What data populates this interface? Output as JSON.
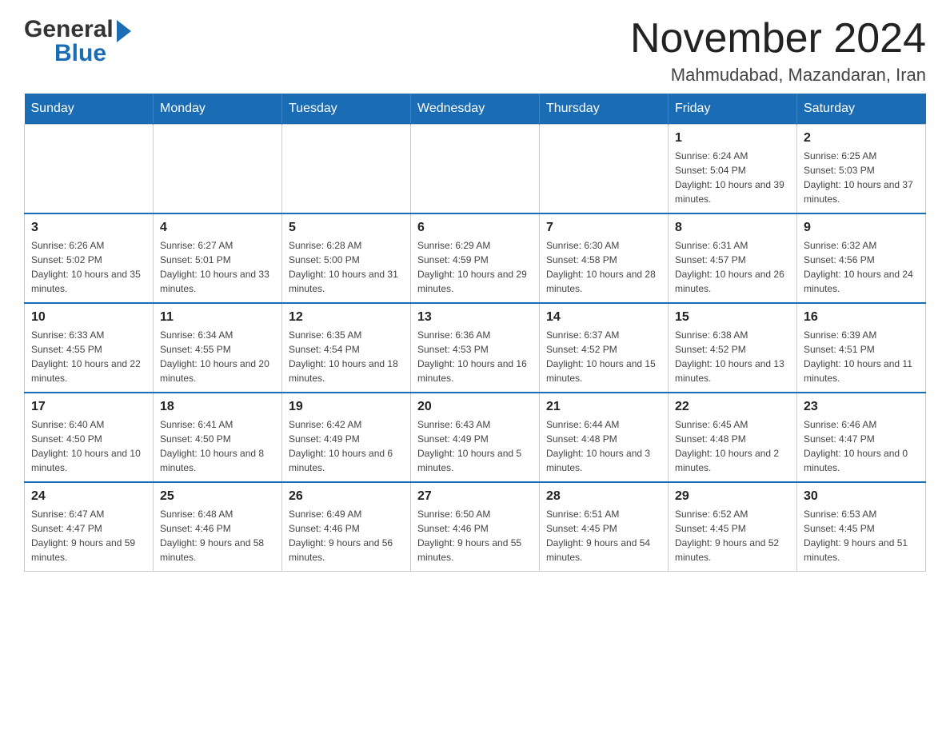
{
  "header": {
    "logo_general": "General",
    "logo_blue": "Blue",
    "title": "November 2024",
    "subtitle": "Mahmudabad, Mazandaran, Iran"
  },
  "weekdays": [
    "Sunday",
    "Monday",
    "Tuesday",
    "Wednesday",
    "Thursday",
    "Friday",
    "Saturday"
  ],
  "weeks": [
    [
      {
        "day": "",
        "sunrise": "",
        "sunset": "",
        "daylight": ""
      },
      {
        "day": "",
        "sunrise": "",
        "sunset": "",
        "daylight": ""
      },
      {
        "day": "",
        "sunrise": "",
        "sunset": "",
        "daylight": ""
      },
      {
        "day": "",
        "sunrise": "",
        "sunset": "",
        "daylight": ""
      },
      {
        "day": "",
        "sunrise": "",
        "sunset": "",
        "daylight": ""
      },
      {
        "day": "1",
        "sunrise": "Sunrise: 6:24 AM",
        "sunset": "Sunset: 5:04 PM",
        "daylight": "Daylight: 10 hours and 39 minutes."
      },
      {
        "day": "2",
        "sunrise": "Sunrise: 6:25 AM",
        "sunset": "Sunset: 5:03 PM",
        "daylight": "Daylight: 10 hours and 37 minutes."
      }
    ],
    [
      {
        "day": "3",
        "sunrise": "Sunrise: 6:26 AM",
        "sunset": "Sunset: 5:02 PM",
        "daylight": "Daylight: 10 hours and 35 minutes."
      },
      {
        "day": "4",
        "sunrise": "Sunrise: 6:27 AM",
        "sunset": "Sunset: 5:01 PM",
        "daylight": "Daylight: 10 hours and 33 minutes."
      },
      {
        "day": "5",
        "sunrise": "Sunrise: 6:28 AM",
        "sunset": "Sunset: 5:00 PM",
        "daylight": "Daylight: 10 hours and 31 minutes."
      },
      {
        "day": "6",
        "sunrise": "Sunrise: 6:29 AM",
        "sunset": "Sunset: 4:59 PM",
        "daylight": "Daylight: 10 hours and 29 minutes."
      },
      {
        "day": "7",
        "sunrise": "Sunrise: 6:30 AM",
        "sunset": "Sunset: 4:58 PM",
        "daylight": "Daylight: 10 hours and 28 minutes."
      },
      {
        "day": "8",
        "sunrise": "Sunrise: 6:31 AM",
        "sunset": "Sunset: 4:57 PM",
        "daylight": "Daylight: 10 hours and 26 minutes."
      },
      {
        "day": "9",
        "sunrise": "Sunrise: 6:32 AM",
        "sunset": "Sunset: 4:56 PM",
        "daylight": "Daylight: 10 hours and 24 minutes."
      }
    ],
    [
      {
        "day": "10",
        "sunrise": "Sunrise: 6:33 AM",
        "sunset": "Sunset: 4:55 PM",
        "daylight": "Daylight: 10 hours and 22 minutes."
      },
      {
        "day": "11",
        "sunrise": "Sunrise: 6:34 AM",
        "sunset": "Sunset: 4:55 PM",
        "daylight": "Daylight: 10 hours and 20 minutes."
      },
      {
        "day": "12",
        "sunrise": "Sunrise: 6:35 AM",
        "sunset": "Sunset: 4:54 PM",
        "daylight": "Daylight: 10 hours and 18 minutes."
      },
      {
        "day": "13",
        "sunrise": "Sunrise: 6:36 AM",
        "sunset": "Sunset: 4:53 PM",
        "daylight": "Daylight: 10 hours and 16 minutes."
      },
      {
        "day": "14",
        "sunrise": "Sunrise: 6:37 AM",
        "sunset": "Sunset: 4:52 PM",
        "daylight": "Daylight: 10 hours and 15 minutes."
      },
      {
        "day": "15",
        "sunrise": "Sunrise: 6:38 AM",
        "sunset": "Sunset: 4:52 PM",
        "daylight": "Daylight: 10 hours and 13 minutes."
      },
      {
        "day": "16",
        "sunrise": "Sunrise: 6:39 AM",
        "sunset": "Sunset: 4:51 PM",
        "daylight": "Daylight: 10 hours and 11 minutes."
      }
    ],
    [
      {
        "day": "17",
        "sunrise": "Sunrise: 6:40 AM",
        "sunset": "Sunset: 4:50 PM",
        "daylight": "Daylight: 10 hours and 10 minutes."
      },
      {
        "day": "18",
        "sunrise": "Sunrise: 6:41 AM",
        "sunset": "Sunset: 4:50 PM",
        "daylight": "Daylight: 10 hours and 8 minutes."
      },
      {
        "day": "19",
        "sunrise": "Sunrise: 6:42 AM",
        "sunset": "Sunset: 4:49 PM",
        "daylight": "Daylight: 10 hours and 6 minutes."
      },
      {
        "day": "20",
        "sunrise": "Sunrise: 6:43 AM",
        "sunset": "Sunset: 4:49 PM",
        "daylight": "Daylight: 10 hours and 5 minutes."
      },
      {
        "day": "21",
        "sunrise": "Sunrise: 6:44 AM",
        "sunset": "Sunset: 4:48 PM",
        "daylight": "Daylight: 10 hours and 3 minutes."
      },
      {
        "day": "22",
        "sunrise": "Sunrise: 6:45 AM",
        "sunset": "Sunset: 4:48 PM",
        "daylight": "Daylight: 10 hours and 2 minutes."
      },
      {
        "day": "23",
        "sunrise": "Sunrise: 6:46 AM",
        "sunset": "Sunset: 4:47 PM",
        "daylight": "Daylight: 10 hours and 0 minutes."
      }
    ],
    [
      {
        "day": "24",
        "sunrise": "Sunrise: 6:47 AM",
        "sunset": "Sunset: 4:47 PM",
        "daylight": "Daylight: 9 hours and 59 minutes."
      },
      {
        "day": "25",
        "sunrise": "Sunrise: 6:48 AM",
        "sunset": "Sunset: 4:46 PM",
        "daylight": "Daylight: 9 hours and 58 minutes."
      },
      {
        "day": "26",
        "sunrise": "Sunrise: 6:49 AM",
        "sunset": "Sunset: 4:46 PM",
        "daylight": "Daylight: 9 hours and 56 minutes."
      },
      {
        "day": "27",
        "sunrise": "Sunrise: 6:50 AM",
        "sunset": "Sunset: 4:46 PM",
        "daylight": "Daylight: 9 hours and 55 minutes."
      },
      {
        "day": "28",
        "sunrise": "Sunrise: 6:51 AM",
        "sunset": "Sunset: 4:45 PM",
        "daylight": "Daylight: 9 hours and 54 minutes."
      },
      {
        "day": "29",
        "sunrise": "Sunrise: 6:52 AM",
        "sunset": "Sunset: 4:45 PM",
        "daylight": "Daylight: 9 hours and 52 minutes."
      },
      {
        "day": "30",
        "sunrise": "Sunrise: 6:53 AM",
        "sunset": "Sunset: 4:45 PM",
        "daylight": "Daylight: 9 hours and 51 minutes."
      }
    ]
  ]
}
